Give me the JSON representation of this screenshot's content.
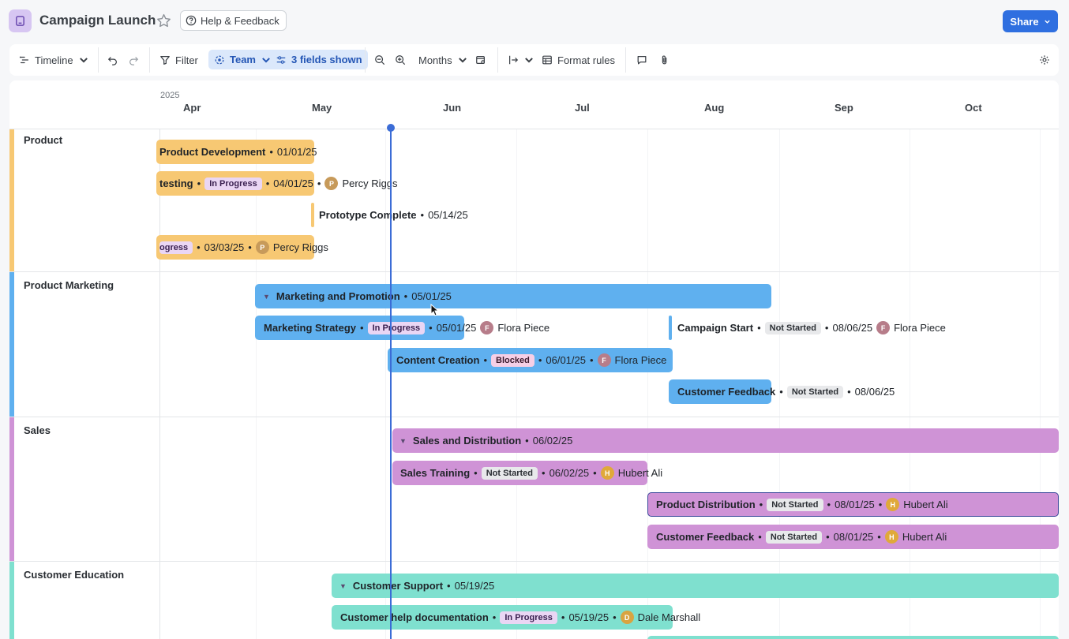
{
  "header": {
    "title": "Campaign Launch",
    "help_label": "Help & Feedback",
    "share_label": "Share"
  },
  "toolbar": {
    "view_label": "Timeline",
    "filter_label": "Filter",
    "group_label": "Team",
    "fields_label": "3 fields shown",
    "scale_label": "Months",
    "format_label": "Format rules"
  },
  "timeline": {
    "year": "2025",
    "months": [
      "Apr",
      "May",
      "Jun",
      "Jul",
      "Aug",
      "Sep",
      "Oct"
    ]
  },
  "groups": [
    {
      "label": "Product",
      "color": "#f7c873"
    },
    {
      "label": "Product Marketing",
      "color": "#5fb0ef"
    },
    {
      "label": "Sales",
      "color": "#cf93d6"
    },
    {
      "label": "Customer Education",
      "color": "#7fe0cf"
    }
  ],
  "product": {
    "r1": {
      "name": "Product Development",
      "date": "01/01/25"
    },
    "r2": {
      "name": "testing",
      "status": "In Progress",
      "date": "04/01/25",
      "owner": "Percy Riggs"
    },
    "r3": {
      "name": "Prototype Complete",
      "date": "05/14/25"
    },
    "r4": {
      "status": "ogress",
      "date": "03/03/25",
      "owner": "Percy Riggs"
    }
  },
  "marketing": {
    "r1": {
      "name": "Marketing and Promotion",
      "date": "05/01/25"
    },
    "r2": {
      "name": "Marketing Strategy",
      "status": "In Progress",
      "date": "05/01/25",
      "owner": "Flora Piece"
    },
    "r2b": {
      "name": "Campaign Start",
      "status": "Not Started",
      "date": "08/06/25",
      "owner": "Flora Piece"
    },
    "r3": {
      "name": "Content Creation",
      "status": "Blocked",
      "date": "06/01/25",
      "owner": "Flora Piece"
    },
    "r4": {
      "name": "Customer Feedback",
      "status": "Not Started",
      "date": "08/06/25"
    }
  },
  "sales": {
    "r1": {
      "name": "Sales and Distribution",
      "date": "06/02/25"
    },
    "r2": {
      "name": "Sales Training",
      "status": "Not Started",
      "date": "06/02/25",
      "owner": "Hubert Ali"
    },
    "r3": {
      "name": "Product Distribution",
      "status": "Not Started",
      "date": "08/01/25",
      "owner": "Hubert Ali"
    },
    "r4": {
      "name": "Customer Feedback",
      "status": "Not Started",
      "date": "08/01/25",
      "owner": "Hubert Ali"
    }
  },
  "education": {
    "r1": {
      "name": "Customer Support",
      "date": "05/19/25"
    },
    "r2": {
      "name": "Customer help documentation",
      "status": "In Progress",
      "date": "05/19/25",
      "owner": "Dale Marshall"
    }
  }
}
